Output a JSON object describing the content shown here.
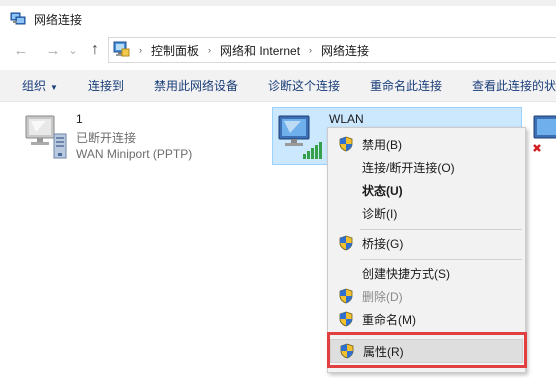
{
  "title_bar": {
    "title": "网络连接"
  },
  "navigation": {
    "back": "←",
    "forward": "→",
    "dropdown": "⌄",
    "up": "↑",
    "crumbs": [
      "控制面板",
      "网络和 Internet",
      "网络连接"
    ],
    "separator": "›"
  },
  "toolbar": {
    "organize": "组织",
    "connect": "连接到",
    "disable": "禁用此网络设备",
    "diagnose": "诊断这个连接",
    "rename": "重命名此连接",
    "view_status": "查看此连接的状"
  },
  "connections": [
    {
      "name": "1",
      "status": "已断开连接",
      "device": "WAN Miniport (PPTP)"
    },
    {
      "name": "WLAN"
    }
  ],
  "context_menu": {
    "items": [
      {
        "label": "禁用(B)",
        "shield": true
      },
      {
        "label": "连接/断开连接(O)",
        "shield": false
      },
      {
        "label": "状态(U)",
        "shield": false,
        "bold": true
      },
      {
        "label": "诊断(I)",
        "shield": false
      },
      {
        "label": "桥接(G)",
        "shield": true
      },
      {
        "label": "创建快捷方式(S)",
        "shield": false
      },
      {
        "label": "删除(D)",
        "shield": true,
        "disabled": true
      },
      {
        "label": "重命名(M)",
        "shield": true
      },
      {
        "label": "属性(R)",
        "shield": true,
        "highlighted": true
      }
    ]
  },
  "colors": {
    "selection_bg": "#cce8ff",
    "toolbar_text": "#1a3e7a",
    "highlight_box": "#e04040"
  }
}
